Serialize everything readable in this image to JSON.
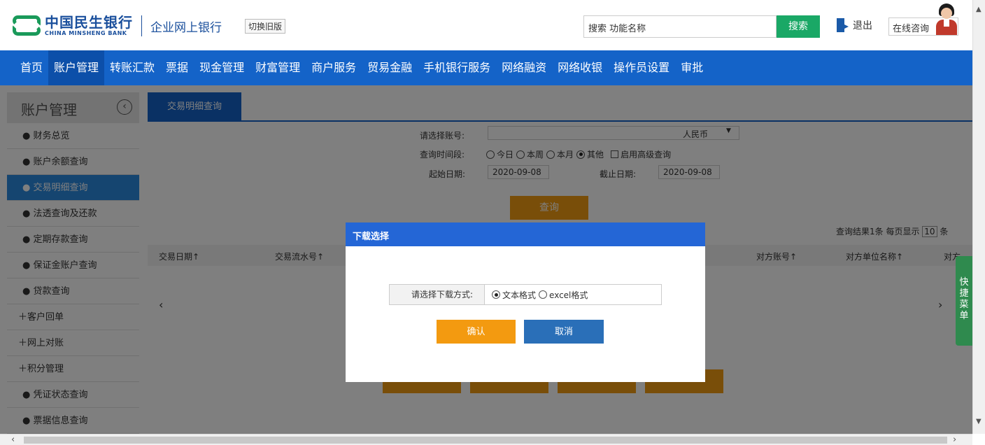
{
  "header": {
    "bank_name_cn": "中国民生银行",
    "bank_name_en": "CHINA MINSHENG BANK",
    "product_name": "企业网上银行",
    "switch_old": "切换旧版",
    "search_placeholder": "搜索 功能名称",
    "search_button": "搜索",
    "logout": "退出",
    "consult": "在线咨询"
  },
  "nav": {
    "items": [
      {
        "label": "首页"
      },
      {
        "label": "账户管理"
      },
      {
        "label": "转账汇款"
      },
      {
        "label": "票据"
      },
      {
        "label": "现金管理"
      },
      {
        "label": "财富管理"
      },
      {
        "label": "商户服务"
      },
      {
        "label": "贸易金融"
      },
      {
        "label": "手机银行服务"
      },
      {
        "label": "网络融资"
      },
      {
        "label": "网络收银"
      },
      {
        "label": "操作员设置"
      },
      {
        "label": "审批"
      }
    ],
    "active_index": 1
  },
  "sidebar": {
    "title": "账户管理",
    "items": [
      {
        "label": "● 财务总览"
      },
      {
        "label": "● 账户余额查询"
      },
      {
        "label": "● 交易明细查询"
      },
      {
        "label": "● 法透查询及还款"
      },
      {
        "label": "● 定期存款查询"
      },
      {
        "label": "● 保证金账户查询"
      },
      {
        "label": "● 贷款查询"
      },
      {
        "label": "＋客户回单"
      },
      {
        "label": "＋网上对账"
      },
      {
        "label": "＋积分管理"
      },
      {
        "label": "● 凭证状态查询"
      },
      {
        "label": "● 票据信息查询"
      }
    ],
    "active_index": 2
  },
  "main": {
    "tab": "交易明细查询",
    "account_label": "请选择账号:",
    "currency": "人民币",
    "period_label": "查询时间段:",
    "period_options": [
      "今日",
      "本周",
      "本月",
      "其他"
    ],
    "advanced_label": "启用高级查询",
    "start_label": "起始日期:",
    "start_date": "2020-09-08",
    "end_label": "截止日期:",
    "end_date": "2020-09-08",
    "query_button": "查询",
    "result_text": "查询结果1条 每页显示",
    "page_size": "10",
    "page_unit": "条",
    "columns": [
      "交易日期↑",
      "交易流水号↑",
      "对方账号↑",
      "对方单位名称↑",
      "对方"
    ]
  },
  "quick_menu": "快捷菜单",
  "modal": {
    "title": "下载选择",
    "label": "请选择下载方式:",
    "options": [
      "文本格式",
      "excel格式"
    ],
    "selected_index": 0,
    "confirm": "确认",
    "cancel": "取消"
  }
}
